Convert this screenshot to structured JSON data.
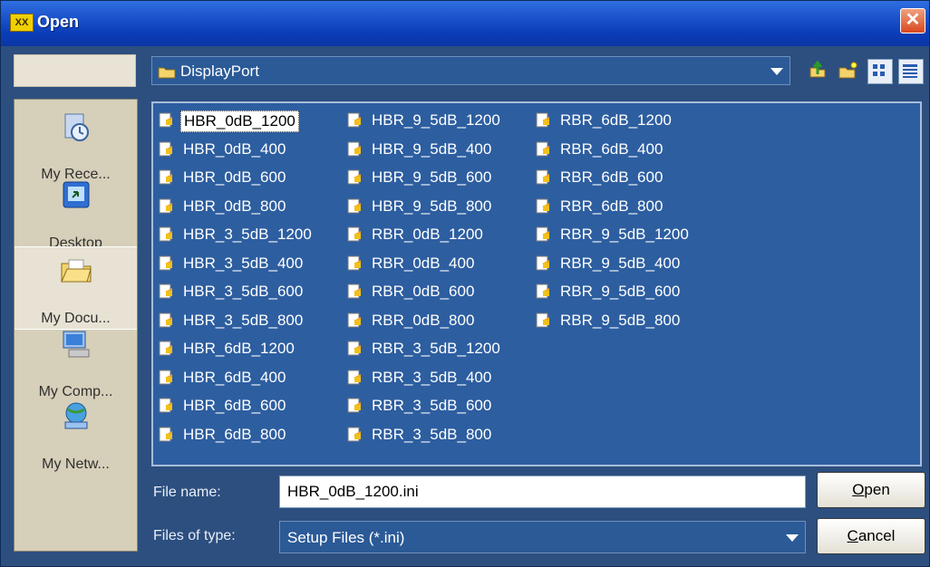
{
  "window": {
    "title": "Open",
    "app_icon_text": "XX"
  },
  "lookin": {
    "value": "DisplayPort"
  },
  "toolbar": {
    "icons": [
      "up-folder-icon",
      "new-folder-icon",
      "list-view-icon",
      "details-view-icon"
    ]
  },
  "places": [
    {
      "label": "My Rece...",
      "icon": "recent-documents-icon"
    },
    {
      "label": "Desktop",
      "icon": "desktop-icon"
    },
    {
      "label": "My Docu...",
      "icon": "my-documents-icon"
    },
    {
      "label": "My Comp...",
      "icon": "my-computer-icon"
    },
    {
      "label": "My Netw...",
      "icon": "my-network-icon"
    }
  ],
  "files": {
    "col1": [
      "HBR_0dB_1200",
      "HBR_0dB_400",
      "HBR_0dB_600",
      "HBR_0dB_800",
      "HBR_3_5dB_1200",
      "HBR_3_5dB_400",
      "HBR_3_5dB_600",
      "HBR_3_5dB_800",
      "HBR_6dB_1200",
      "HBR_6dB_400",
      "HBR_6dB_600",
      "HBR_6dB_800"
    ],
    "col2": [
      "HBR_9_5dB_1200",
      "HBR_9_5dB_400",
      "HBR_9_5dB_600",
      "HBR_9_5dB_800",
      "RBR_0dB_1200",
      "RBR_0dB_400",
      "RBR_0dB_600",
      "RBR_0dB_800",
      "RBR_3_5dB_1200",
      "RBR_3_5dB_400",
      "RBR_3_5dB_600",
      "RBR_3_5dB_800"
    ],
    "col3": [
      "RBR_6dB_1200",
      "RBR_6dB_400",
      "RBR_6dB_600",
      "RBR_6dB_800",
      "RBR_9_5dB_1200",
      "RBR_9_5dB_400",
      "RBR_9_5dB_600",
      "RBR_9_5dB_800"
    ],
    "selected": "HBR_0dB_1200"
  },
  "filename": {
    "label": "File name:",
    "value": "HBR_0dB_1200.ini"
  },
  "filetype": {
    "label": "Files of type:",
    "value": "Setup Files (*.ini)"
  },
  "buttons": {
    "open": "Open",
    "cancel": "Cancel"
  },
  "colors": {
    "background": "#2c4f7f",
    "list_bg": "#2d5ea0",
    "title_bar": "#1f58cf",
    "close": "#d9471f"
  }
}
